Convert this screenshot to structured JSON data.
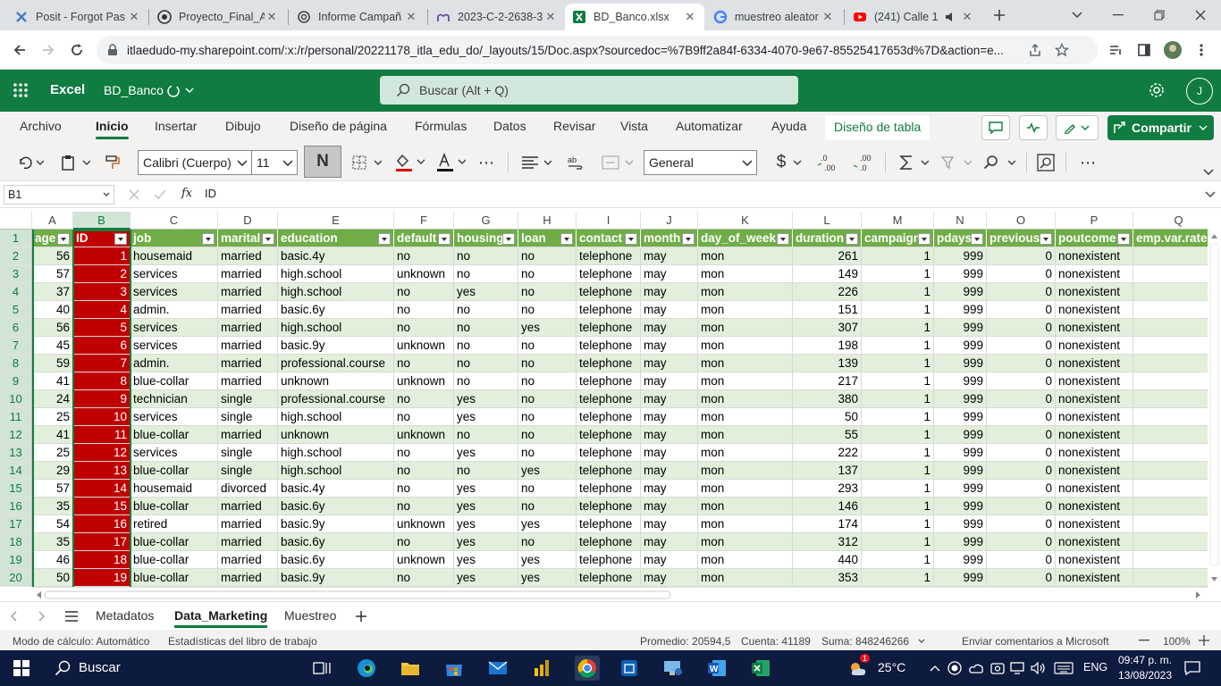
{
  "browser": {
    "tabs": [
      {
        "label": "Posit - Forgot Pas",
        "icon": "posit-icon"
      },
      {
        "label": "Proyecto_Final_Ar",
        "icon": "github-icon"
      },
      {
        "label": "Informe Campañ",
        "icon": "chatgpt-icon"
      },
      {
        "label": "2023-C-2-2638-3",
        "icon": "moodle-icon"
      },
      {
        "label": "BD_Banco.xlsx",
        "icon": "excel-icon"
      },
      {
        "label": "muestreo aleator",
        "icon": "google-icon"
      },
      {
        "label": "(241) Calle 1",
        "icon": "youtube-icon"
      }
    ],
    "url": "itlaedudo-my.sharepoint.com/:x:/r/personal/20221178_itla_edu_do/_layouts/15/Doc.aspx?sourcedoc=%7B9ff2a84f-6334-4070-9e67-85525417653d%7D&action=e..."
  },
  "excel": {
    "app_name": "Excel",
    "file_name": "BD_Banco",
    "search_placeholder": "Buscar (Alt + Q)",
    "avatar_initial": "J",
    "ribbon_tabs": [
      "Archivo",
      "Inicio",
      "Insertar",
      "Dibujo",
      "Diseño de página",
      "Fórmulas",
      "Datos",
      "Revisar",
      "Vista",
      "Automatizar",
      "Ayuda",
      "Diseño de tabla"
    ],
    "share_label": "Compartir",
    "font_name": "Calibri (Cuerpo)",
    "font_size": "11",
    "bold_label": "N",
    "number_format": "General",
    "currency_symbol": "$",
    "name_box": "B1",
    "formula_value": "ID",
    "fx_label": "fx"
  },
  "grid": {
    "col_letters": [
      "A",
      "B",
      "C",
      "D",
      "E",
      "F",
      "G",
      "H",
      "I",
      "J",
      "K",
      "L",
      "M",
      "N",
      "O",
      "P",
      "Q"
    ],
    "headers": [
      "age",
      "ID",
      "job",
      "marital",
      "education",
      "default",
      "housing",
      "loan",
      "contact",
      "month",
      "day_of_week",
      "duration",
      "campaign",
      "pdays",
      "previous",
      "poutcome",
      "emp.var.rate"
    ],
    "row_numbers": [
      "1",
      "2",
      "3",
      "4",
      "5",
      "6",
      "7",
      "8",
      "9",
      "10",
      "11",
      "12",
      "13",
      "14",
      "15",
      "16",
      "17",
      "18",
      "19",
      "20"
    ],
    "rows": [
      [
        "56",
        "1",
        "housemaid",
        "married",
        "basic.4y",
        "no",
        "no",
        "no",
        "telephone",
        "may",
        "mon",
        "261",
        "1",
        "999",
        "0",
        "nonexistent",
        ""
      ],
      [
        "57",
        "2",
        "services",
        "married",
        "high.school",
        "unknown",
        "no",
        "no",
        "telephone",
        "may",
        "mon",
        "149",
        "1",
        "999",
        "0",
        "nonexistent",
        ""
      ],
      [
        "37",
        "3",
        "services",
        "married",
        "high.school",
        "no",
        "yes",
        "no",
        "telephone",
        "may",
        "mon",
        "226",
        "1",
        "999",
        "0",
        "nonexistent",
        ""
      ],
      [
        "40",
        "4",
        "admin.",
        "married",
        "basic.6y",
        "no",
        "no",
        "no",
        "telephone",
        "may",
        "mon",
        "151",
        "1",
        "999",
        "0",
        "nonexistent",
        ""
      ],
      [
        "56",
        "5",
        "services",
        "married",
        "high.school",
        "no",
        "no",
        "yes",
        "telephone",
        "may",
        "mon",
        "307",
        "1",
        "999",
        "0",
        "nonexistent",
        ""
      ],
      [
        "45",
        "6",
        "services",
        "married",
        "basic.9y",
        "unknown",
        "no",
        "no",
        "telephone",
        "may",
        "mon",
        "198",
        "1",
        "999",
        "0",
        "nonexistent",
        ""
      ],
      [
        "59",
        "7",
        "admin.",
        "married",
        "professional.course",
        "no",
        "no",
        "no",
        "telephone",
        "may",
        "mon",
        "139",
        "1",
        "999",
        "0",
        "nonexistent",
        ""
      ],
      [
        "41",
        "8",
        "blue-collar",
        "married",
        "unknown",
        "unknown",
        "no",
        "no",
        "telephone",
        "may",
        "mon",
        "217",
        "1",
        "999",
        "0",
        "nonexistent",
        ""
      ],
      [
        "24",
        "9",
        "technician",
        "single",
        "professional.course",
        "no",
        "yes",
        "no",
        "telephone",
        "may",
        "mon",
        "380",
        "1",
        "999",
        "0",
        "nonexistent",
        ""
      ],
      [
        "25",
        "10",
        "services",
        "single",
        "high.school",
        "no",
        "yes",
        "no",
        "telephone",
        "may",
        "mon",
        "50",
        "1",
        "999",
        "0",
        "nonexistent",
        ""
      ],
      [
        "41",
        "11",
        "blue-collar",
        "married",
        "unknown",
        "unknown",
        "no",
        "no",
        "telephone",
        "may",
        "mon",
        "55",
        "1",
        "999",
        "0",
        "nonexistent",
        ""
      ],
      [
        "25",
        "12",
        "services",
        "single",
        "high.school",
        "no",
        "yes",
        "no",
        "telephone",
        "may",
        "mon",
        "222",
        "1",
        "999",
        "0",
        "nonexistent",
        ""
      ],
      [
        "29",
        "13",
        "blue-collar",
        "single",
        "high.school",
        "no",
        "no",
        "yes",
        "telephone",
        "may",
        "mon",
        "137",
        "1",
        "999",
        "0",
        "nonexistent",
        ""
      ],
      [
        "57",
        "14",
        "housemaid",
        "divorced",
        "basic.4y",
        "no",
        "yes",
        "no",
        "telephone",
        "may",
        "mon",
        "293",
        "1",
        "999",
        "0",
        "nonexistent",
        ""
      ],
      [
        "35",
        "15",
        "blue-collar",
        "married",
        "basic.6y",
        "no",
        "yes",
        "no",
        "telephone",
        "may",
        "mon",
        "146",
        "1",
        "999",
        "0",
        "nonexistent",
        ""
      ],
      [
        "54",
        "16",
        "retired",
        "married",
        "basic.9y",
        "unknown",
        "yes",
        "yes",
        "telephone",
        "may",
        "mon",
        "174",
        "1",
        "999",
        "0",
        "nonexistent",
        ""
      ],
      [
        "35",
        "17",
        "blue-collar",
        "married",
        "basic.6y",
        "no",
        "yes",
        "no",
        "telephone",
        "may",
        "mon",
        "312",
        "1",
        "999",
        "0",
        "nonexistent",
        ""
      ],
      [
        "46",
        "18",
        "blue-collar",
        "married",
        "basic.6y",
        "unknown",
        "yes",
        "yes",
        "telephone",
        "may",
        "mon",
        "440",
        "1",
        "999",
        "0",
        "nonexistent",
        ""
      ],
      [
        "50",
        "19",
        "blue-collar",
        "married",
        "basic.9y",
        "no",
        "yes",
        "yes",
        "telephone",
        "may",
        "mon",
        "353",
        "1",
        "999",
        "0",
        "nonexistent",
        ""
      ]
    ]
  },
  "sheets": [
    "Metadatos",
    "Data_Marketing",
    "Muestreo"
  ],
  "status": {
    "calc_mode": "Modo de cálculo: Automático",
    "workbook_stats": "Estadísticas del libro de trabajo",
    "average": "Promedio: 20594,5",
    "count": "Cuenta: 41189",
    "sum": "Suma: 848246266",
    "feedback": "Enviar comentarios a Microsoft",
    "zoom": "100%"
  },
  "taskbar": {
    "search_label": "Buscar",
    "weather": "25°C",
    "language": "ENG",
    "time": "09:47 p. m.",
    "date": "13/08/2023",
    "weather_badge": "1"
  },
  "colors": {
    "excel_green": "#107c41",
    "table_header": "#70ad47",
    "band": "#e2efda",
    "id_highlight": "#c00000"
  }
}
